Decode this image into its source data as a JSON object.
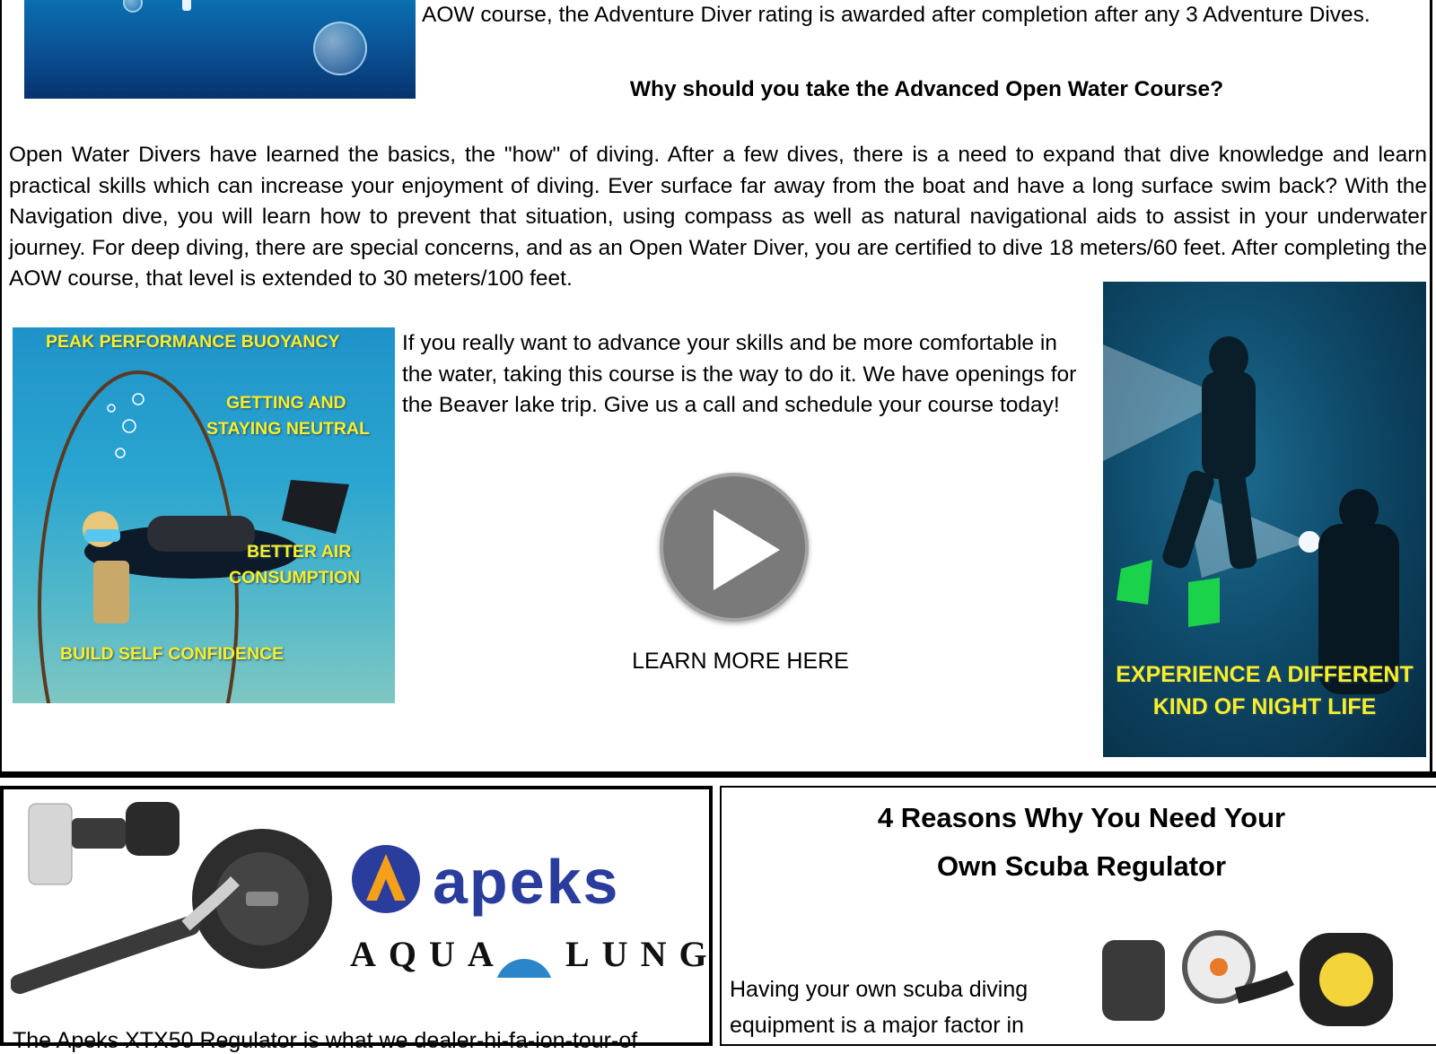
{
  "intro_tail": "AOW course, the Adventure Diver rating is awarded after completion after any 3 Adventure Dives.",
  "why_heading": "Why should you take the Advanced Open Water Course?",
  "why_paragraph": "Open Water Divers have learned the basics, the \"how\" of diving. After a few dives, there is a need to expand that dive knowledge and learn practical skills which can increase your enjoyment of diving. Ever surface far away from the boat and have a long surface swim back? With the Navigation dive, you will learn how to prevent that situation, using compass as well as natural navigational aids to assist in your underwater journey. For deep diving, there are special concerns, and as an Open Water Diver, you are certified to dive 18 meters/60 feet. After completing the AOW course, that level is extended to 30 meters/100 feet.",
  "advance_paragraph": "If you really want to advance your skills and be more comfortable in the water, taking this course is the way to do it.  We have openings for the  Beaver lake trip.  Give us a call and schedule your course   today!",
  "learn_more": "LEARN MORE HERE",
  "buoyancy_image": {
    "label_1": "PEAK PERFORMANCE BUOYANCY",
    "label_2a": "GETTING AND",
    "label_2b": "STAYING NEUTRAL",
    "label_3a": "BETTER AIR",
    "label_3b": "CONSUMPTION",
    "label_4": "BUILD SELF CONFIDENCE"
  },
  "night_image": {
    "line_1": "EXPERIENCE A DIFFERENT",
    "line_2": "KIND OF NIGHT LIFE"
  },
  "apeks_ad": {
    "brand": "apeks",
    "sub_brand_left": "AQUA",
    "sub_brand_right": "LUNG",
    "caption_partial": "The Apeks XTX50 Regulator is what we dealer-hi-fa-ion-tour-of"
  },
  "regulator_article": {
    "title_line_1": "4 Reasons Why You Need Your",
    "title_line_2": "Own Scuba Regulator",
    "text_partial": "Having your own scuba diving equipment is a major factor in"
  },
  "colors": {
    "label_yellow": "#f7ef2a",
    "apeks_blue": "#2a3d9c",
    "apeks_orange": "#f5a01a",
    "play_gray": "#7a7a7a"
  }
}
